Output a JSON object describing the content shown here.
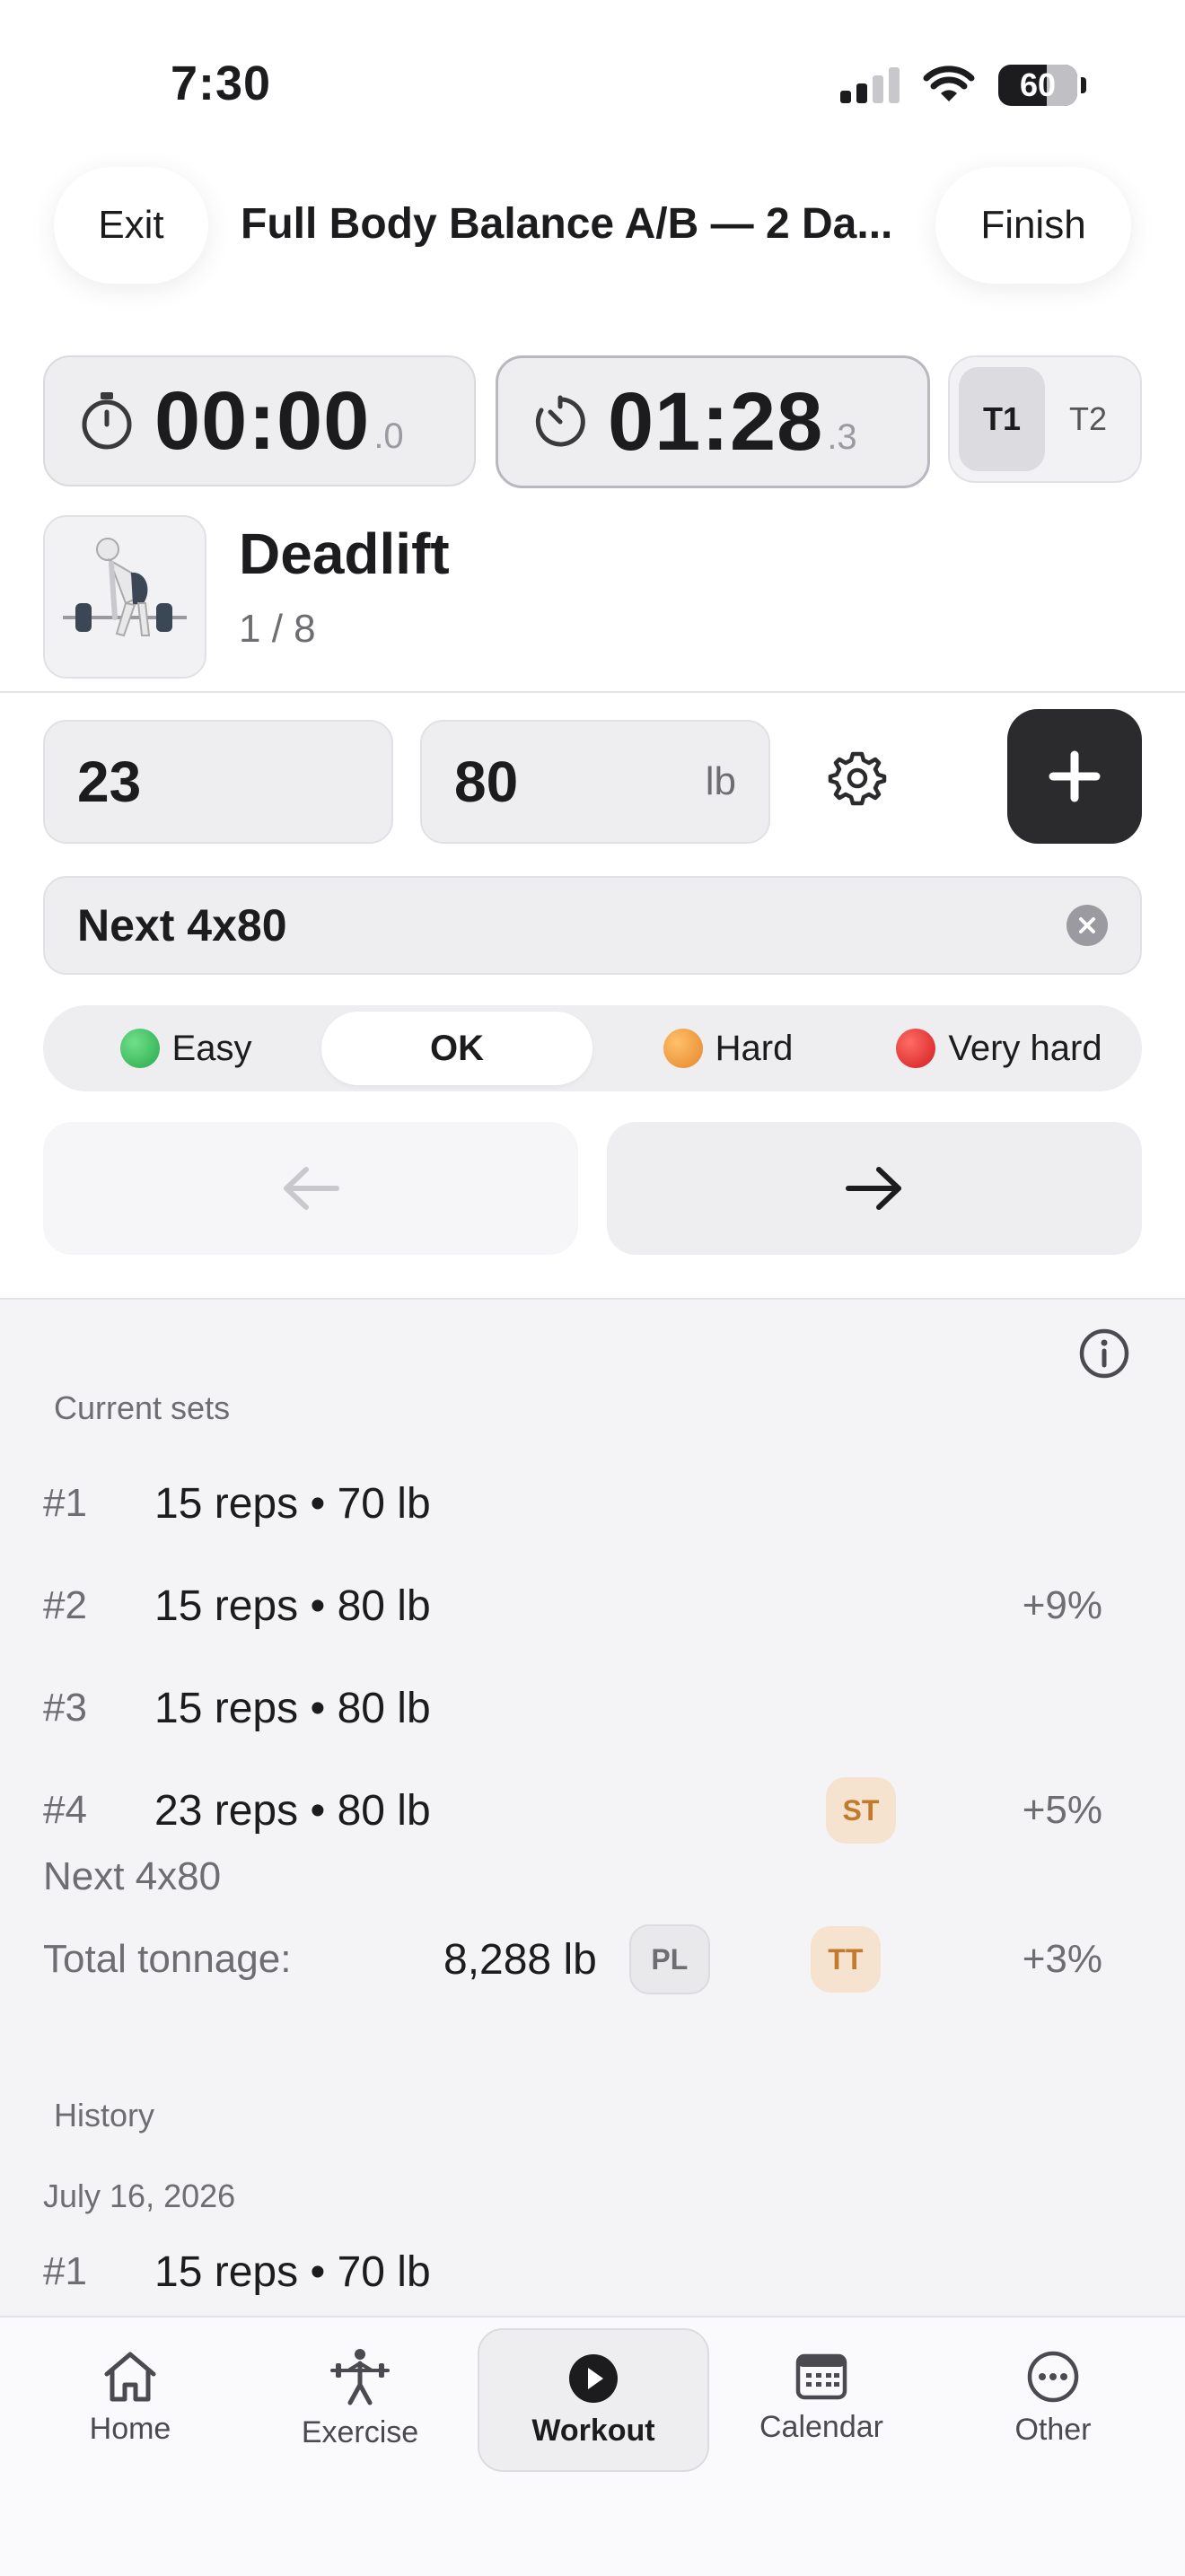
{
  "status": {
    "time": "7:30",
    "battery": "60"
  },
  "header": {
    "exit_label": "Exit",
    "title": "Full Body Balance A/B — 2 Da...",
    "finish_label": "Finish"
  },
  "timers": {
    "workout": {
      "main": "00:00",
      "fraction": ".0"
    },
    "rest": {
      "main": "01:28",
      "fraction": ".3"
    },
    "toggle": [
      "T1",
      "T2"
    ],
    "toggle_selected": "T1"
  },
  "exercise": {
    "name": "Deadlift",
    "progress": "1 / 8"
  },
  "input": {
    "reps": "23",
    "weight": "80",
    "unit": "lb",
    "note": "Next 4x80"
  },
  "difficulty": {
    "options": [
      {
        "label": "Easy",
        "color": "#34c759"
      },
      {
        "label": "OK",
        "color": ""
      },
      {
        "label": "Hard",
        "color": "#f0972f"
      },
      {
        "label": "Very hard",
        "color": "#e5282a"
      }
    ],
    "selected": "OK"
  },
  "current_sets": {
    "label": "Current sets",
    "rows": [
      {
        "num": "#1",
        "text": "15 reps • 70 lb",
        "badge": "",
        "pct": ""
      },
      {
        "num": "#2",
        "text": "15 reps • 80 lb",
        "badge": "",
        "pct": "+9%"
      },
      {
        "num": "#3",
        "text": "15 reps • 80 lb",
        "badge": "",
        "pct": ""
      },
      {
        "num": "#4",
        "text": "23 reps • 80 lb",
        "badge": "ST",
        "pct": "+5%"
      }
    ],
    "note": "Next 4x80",
    "tonnage_label": "Total tonnage:",
    "tonnage_value": "8,288 lb",
    "tonnage_badge_pl": "PL",
    "tonnage_badge_tt": "TT",
    "tonnage_pct": "+3%"
  },
  "history": {
    "label": "History",
    "date": "July 16, 2026",
    "rows": [
      {
        "num": "#1",
        "text": "15 reps • 70 lb"
      }
    ]
  },
  "tabbar": {
    "items": [
      {
        "label": "Home",
        "icon": "home-icon"
      },
      {
        "label": "Exercise",
        "icon": "exercise-icon"
      },
      {
        "label": "Workout",
        "icon": "play-icon"
      },
      {
        "label": "Calendar",
        "icon": "calendar-icon"
      },
      {
        "label": "Other",
        "icon": "more-icon"
      }
    ],
    "selected": "Workout"
  }
}
